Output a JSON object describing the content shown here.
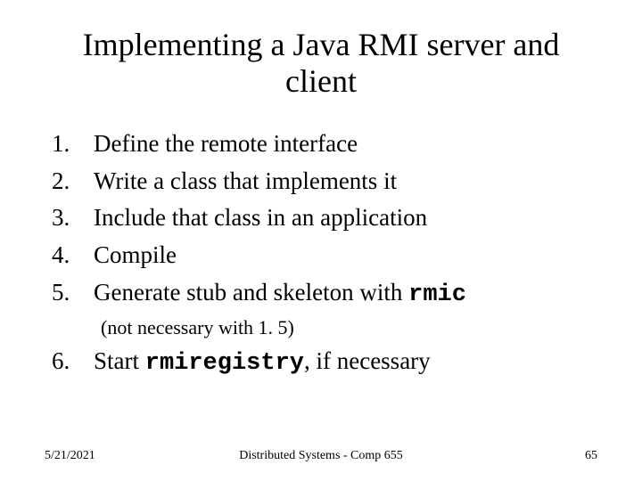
{
  "title": "Implementing a Java RMI server and client",
  "items": [
    {
      "num": "1.",
      "text": "Define the remote interface"
    },
    {
      "num": "2.",
      "text": "Write a class that implements it"
    },
    {
      "num": "3.",
      "text": "Include that class in an application"
    },
    {
      "num": "4.",
      "text": "Compile"
    },
    {
      "num": "5.",
      "text_pre": "Generate stub and skeleton with ",
      "code": "rmic"
    }
  ],
  "note": "(not necessary with 1. 5)",
  "item6": {
    "num": "6.",
    "text_pre": "Start ",
    "code": "rmiregistry",
    "text_post": ", if necessary"
  },
  "footer": {
    "date": "5/21/2021",
    "course": "Distributed Systems - Comp 655",
    "page": "65"
  }
}
